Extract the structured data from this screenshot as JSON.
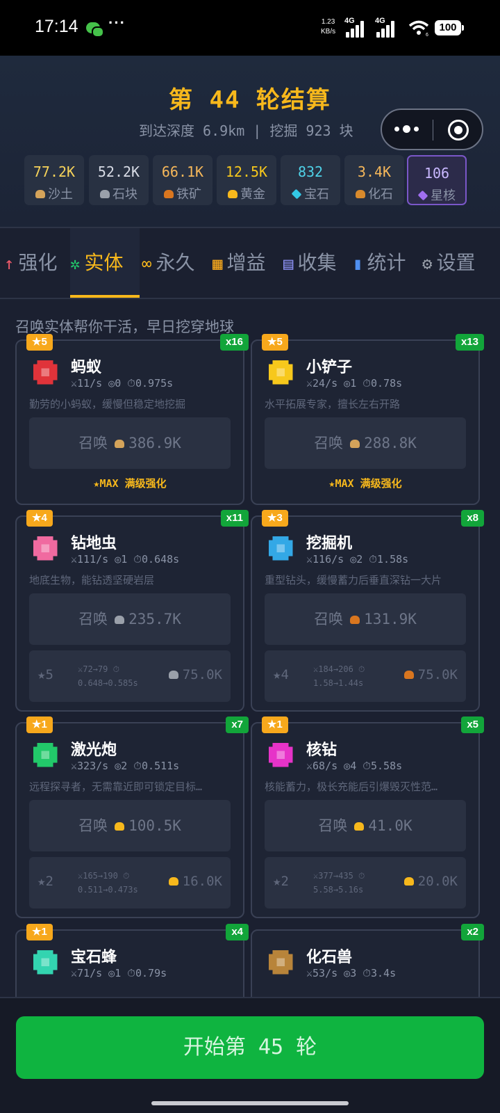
{
  "status_bar": {
    "time": "17:14",
    "net_speed_value": "1.23",
    "net_speed_unit": "KB/s",
    "signal_1": "4G",
    "signal_2": "4G",
    "wifi_sub": "6",
    "battery": "100"
  },
  "header": {
    "title": "第 44 轮结算",
    "subtitle": "到达深度 6.9km | 挖掘 923 块",
    "resources": [
      {
        "value": "77.2K",
        "name": "沙土",
        "value_color": "#f7d35a",
        "icon": "sand-icon",
        "icon_color": "#d4a35a"
      },
      {
        "value": "52.2K",
        "name": "石块",
        "value_color": "#d8dce6",
        "icon": "stone-icon",
        "icon_color": "#9aa0aa"
      },
      {
        "value": "66.1K",
        "name": "铁矿",
        "value_color": "#f7b85a",
        "icon": "iron-ore-icon",
        "icon_color": "#d9761f"
      },
      {
        "value": "12.5K",
        "name": "黄金",
        "value_color": "#f7c81c",
        "icon": "gold-icon",
        "icon_color": "#f7b81c"
      },
      {
        "value": "832",
        "name": "宝石",
        "value_color": "#4fd2e8",
        "icon": "gem-icon",
        "icon_color": "#33c8e6"
      },
      {
        "value": "3.4K",
        "name": "化石",
        "value_color": "#f7b85a",
        "icon": "fossil-icon",
        "icon_color": "#d88a2c"
      },
      {
        "value": "106",
        "name": "星核",
        "value_color": "#c9b8ff",
        "icon": "star-core-icon",
        "icon_color": "#a06ff0"
      }
    ]
  },
  "tabs": [
    {
      "icon": "↑",
      "icon_name": "arrow-up-icon",
      "label": "强化",
      "icon_color": "#f05a6a"
    },
    {
      "icon": "✲",
      "icon_name": "gear-green-icon",
      "label": "实体",
      "icon_color": "#22c96a",
      "active": true
    },
    {
      "icon": "∞",
      "icon_name": "infinity-icon",
      "label": "永久",
      "icon_color": "#f7b81c"
    },
    {
      "icon": "▦",
      "icon_name": "shop-icon",
      "label": "增益",
      "icon_color": "#f7a81c"
    },
    {
      "icon": "▤",
      "icon_name": "book-icon",
      "label": "收集",
      "icon_color": "#8a8ff0"
    },
    {
      "icon": "▮",
      "icon_name": "bar-chart-icon",
      "label": "统计",
      "icon_color": "#4f8ff0"
    },
    {
      "icon": "⚙",
      "icon_name": "settings-icon",
      "label": "设置",
      "icon_color": "#9aa0aa"
    }
  ],
  "content": {
    "tagline": "召唤实体帮你干活，早日挖穿地球",
    "entities": [
      {
        "stars": "★5",
        "count": "x16",
        "name": "蚂蚁",
        "stats": "⚔11/s ◎0 ⏱0.975s",
        "desc": "勤劳的小蚂蚁，缓慢但稳定地挖掘",
        "summon_label": "召唤",
        "summon_cost": "386.9K",
        "cost_color": "#d4a35a",
        "max_label": "★MAX 满级强化",
        "icon": "ant-icon"
      },
      {
        "stars": "★5",
        "count": "x13",
        "name": "小铲子",
        "stats": "⚔24/s ◎1 ⏱0.78s",
        "desc": "水平拓展专家，擅长左右开路",
        "summon_label": "召唤",
        "summon_cost": "288.8K",
        "cost_color": "#d4a35a",
        "max_label": "★MAX 满级强化",
        "icon": "shovel-icon"
      },
      {
        "stars": "★4",
        "count": "x11",
        "name": "钻地虫",
        "stats": "⚔111/s ◎1 ⏱0.648s",
        "desc": "地底生物，能钻透坚硬岩层",
        "summon_label": "召唤",
        "summon_cost": "235.7K",
        "cost_color": "#9aa0aa",
        "upgrade": {
          "star": "★5",
          "line1": "⚔72→79 ⏱",
          "line2": "0.648→0.585s",
          "cost": "75.0K",
          "cost_color": "#9aa0aa"
        },
        "icon": "drill-worm-icon"
      },
      {
        "stars": "★3",
        "count": "x8",
        "name": "挖掘机",
        "stats": "⚔116/s ◎2 ⏱1.58s",
        "desc": "重型钻头，缓慢蓄力后垂直深钻一大片",
        "summon_label": "召唤",
        "summon_cost": "131.9K",
        "cost_color": "#d9761f",
        "upgrade": {
          "star": "★4",
          "line1": "⚔184→206 ⏱",
          "line2": "1.58→1.44s",
          "cost": "75.0K",
          "cost_color": "#d9761f"
        },
        "icon": "excavator-icon"
      },
      {
        "stars": "★1",
        "count": "x7",
        "name": "激光炮",
        "stats": "⚔323/s ◎2 ⏱0.511s",
        "desc": "远程探寻者，无需靠近即可锁定目标…",
        "summon_label": "召唤",
        "summon_cost": "100.5K",
        "cost_color": "#f7b81c",
        "upgrade": {
          "star": "★2",
          "line1": "⚔165→190 ⏱",
          "line2": "0.511→0.473s",
          "cost": "16.0K",
          "cost_color": "#f7b81c"
        },
        "icon": "laser-cannon-icon"
      },
      {
        "stars": "★1",
        "count": "x5",
        "name": "核钻",
        "stats": "⚔68/s ◎4 ⏱5.58s",
        "desc": "核能蓄力，极长充能后引爆毁灭性范…",
        "summon_label": "召唤",
        "summon_cost": "41.0K",
        "cost_color": "#f7b81c",
        "upgrade": {
          "star": "★2",
          "line1": "⚔377→435 ⏱",
          "line2": "5.58→5.16s",
          "cost": "20.0K",
          "cost_color": "#f7b81c"
        },
        "icon": "nuclear-drill-icon"
      },
      {
        "stars": "★1",
        "count": "x4",
        "name": "宝石蜂",
        "stats": "⚔71/s ◎1 ⏱0.79s",
        "icon": "gem-bee-icon"
      },
      {
        "stars": "",
        "count": "x2",
        "name": "化石兽",
        "stats": "⚔53/s ◎3 ⏱3.4s",
        "icon": "fossil-beast-icon"
      }
    ]
  },
  "bottom": {
    "start_label": "开始第 45 轮"
  }
}
